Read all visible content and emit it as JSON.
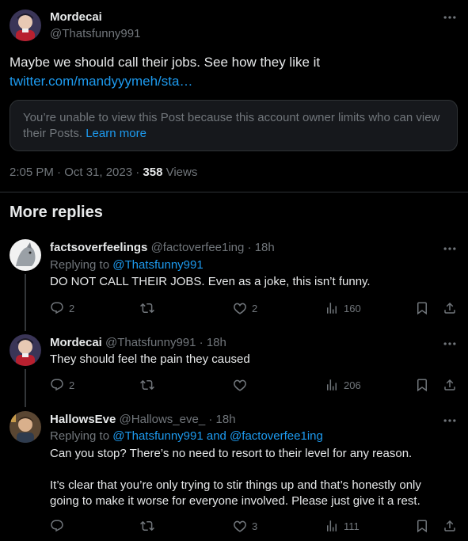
{
  "main_post": {
    "display_name": "Mordecai",
    "handle": "@Thatsfunny991",
    "text": "Maybe we should call their  jobs. See how they like it",
    "link": "twitter.com/mandyyymeh/sta…",
    "notice": "You’re unable to view this Post because this account owner limits who can view their Posts.",
    "notice_link": "Learn more",
    "timestamp": "2:05 PM · Oct 31, 2023 · ",
    "views_count": "358",
    "views_label": " Views"
  },
  "more_replies_heading": "More replies",
  "replies": [
    {
      "display_name": "factsoverfeelings",
      "handle": "@factoverfee1ing",
      "time": "· 18h",
      "replying_prefix": "Replying to ",
      "replying_to": "@Thatsfunny991",
      "text": "DO NOT CALL THEIR JOBS. Even as a joke, this isn’t funny.",
      "reply_count": "2",
      "retweet_count": "",
      "like_count": "2",
      "view_count": "160"
    },
    {
      "display_name": "Mordecai",
      "handle": "@Thatsfunny991",
      "time": "· 18h",
      "text": "They should feel the pain they caused",
      "reply_count": "2",
      "retweet_count": "",
      "like_count": "",
      "view_count": "206"
    },
    {
      "display_name": "HallowsEve",
      "handle": "@Hallows_eve_",
      "time": "· 18h",
      "replying_prefix": "Replying to ",
      "replying_to": "@Thatsfunny991 and @factoverfee1ing",
      "text1": "Can you stop? There’s no need to resort to their level for any reason.",
      "text2": "It’s clear that you’re only trying to stir things up and that’s honestly only going to make it worse for everyone involved. Please just give it a rest.",
      "reply_count": "",
      "retweet_count": "",
      "like_count": "3",
      "view_count": "111"
    }
  ],
  "colors": {
    "background": "#000000",
    "text": "#e7e9ea",
    "muted": "#71767b",
    "accent": "#1d9bf0",
    "border": "#2f3336"
  }
}
